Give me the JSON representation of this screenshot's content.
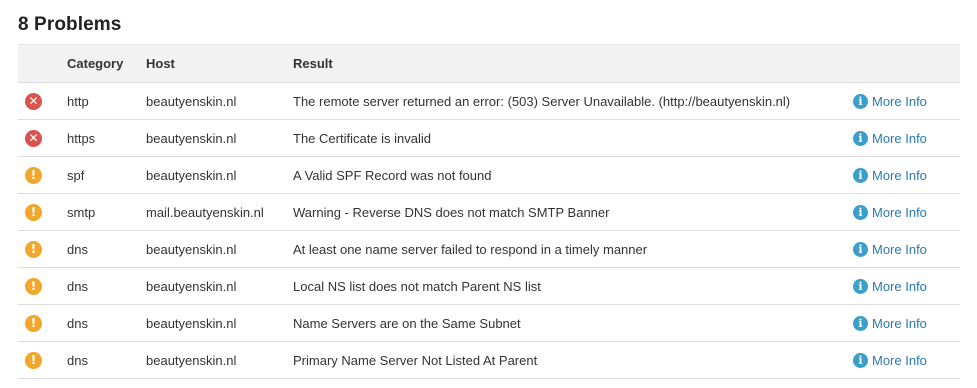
{
  "heading": "8 Problems",
  "columns": {
    "category": "Category",
    "host": "Host",
    "result": "Result"
  },
  "more_info_label": "More Info",
  "colors": {
    "error": "#d9534f",
    "warning": "#f0a72b",
    "link": "#2a7ab0",
    "info_icon": "#3aa0c9"
  },
  "rows": [
    {
      "status": "error",
      "status_icon": "error-x-icon",
      "status_glyph": "✕",
      "category": "http",
      "host": "beautyenskin.nl",
      "result": "The remote server returned an error: (503) Server Unavailable. (http://beautyenskin.nl)"
    },
    {
      "status": "error",
      "status_icon": "error-x-icon",
      "status_glyph": "✕",
      "category": "https",
      "host": "beautyenskin.nl",
      "result": "The Certificate is invalid"
    },
    {
      "status": "warning",
      "status_icon": "warning-exclamation-icon",
      "status_glyph": "!",
      "category": "spf",
      "host": "beautyenskin.nl",
      "result": "A Valid SPF Record was not found"
    },
    {
      "status": "warning",
      "status_icon": "warning-exclamation-icon",
      "status_glyph": "!",
      "category": "smtp",
      "host": "mail.beautyenskin.nl",
      "result": "Warning - Reverse DNS does not match SMTP Banner"
    },
    {
      "status": "warning",
      "status_icon": "warning-exclamation-icon",
      "status_glyph": "!",
      "category": "dns",
      "host": "beautyenskin.nl",
      "result": "At least one name server failed to respond in a timely manner"
    },
    {
      "status": "warning",
      "status_icon": "warning-exclamation-icon",
      "status_glyph": "!",
      "category": "dns",
      "host": "beautyenskin.nl",
      "result": "Local NS list does not match Parent NS list"
    },
    {
      "status": "warning",
      "status_icon": "warning-exclamation-icon",
      "status_glyph": "!",
      "category": "dns",
      "host": "beautyenskin.nl",
      "result": "Name Servers are on the Same Subnet"
    },
    {
      "status": "warning",
      "status_icon": "warning-exclamation-icon",
      "status_glyph": "!",
      "category": "dns",
      "host": "beautyenskin.nl",
      "result": "Primary Name Server Not Listed At Parent"
    }
  ]
}
